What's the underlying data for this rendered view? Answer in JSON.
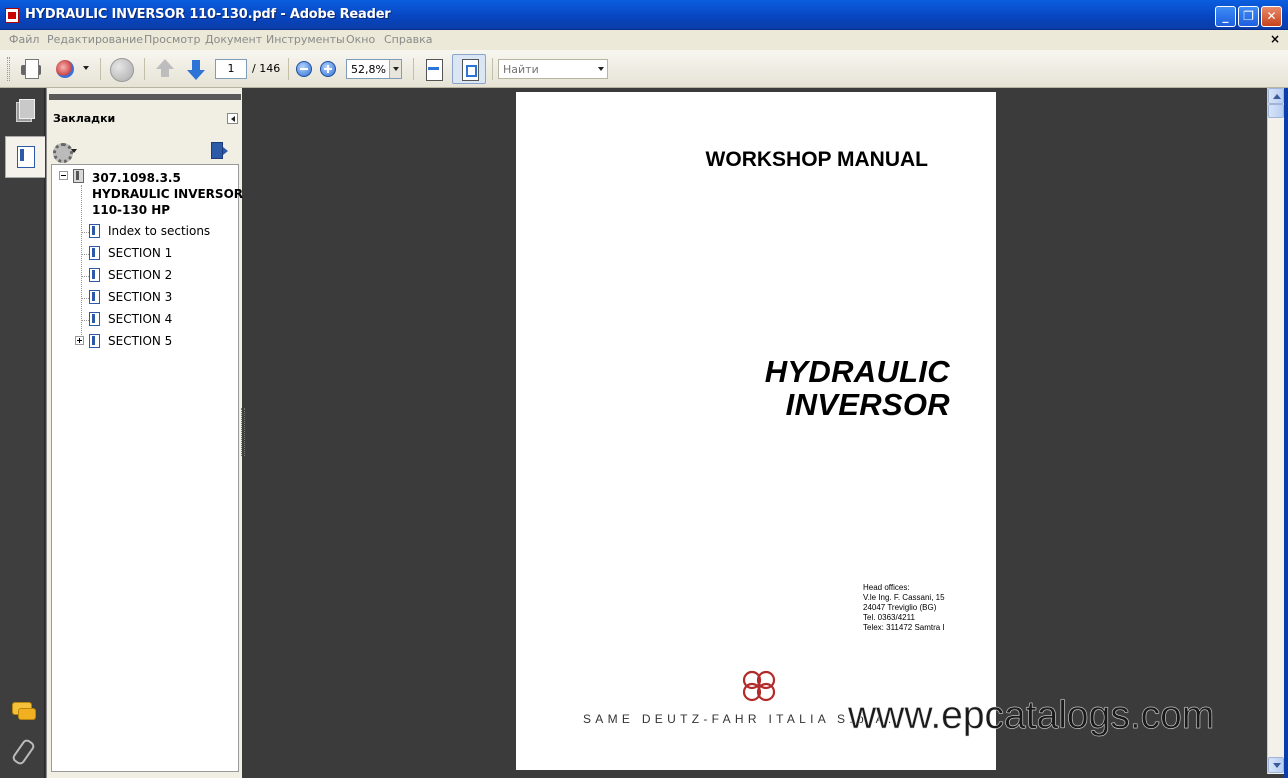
{
  "window": {
    "title": "HYDRAULIC INVERSOR 110-130.pdf - Adobe Reader",
    "min_label": "_",
    "max_label": "❐",
    "close_label": "✕"
  },
  "menu": {
    "items": [
      "Файл",
      "Редактирование",
      "Просмотр",
      "Документ",
      "Инструменты",
      "Окно",
      "Справка"
    ],
    "close_label": "×"
  },
  "toolbar": {
    "page_current": "1",
    "page_total": "/ 146",
    "zoom": "52,8%",
    "find_placeholder": "Найти"
  },
  "bookmarks": {
    "title": "Закладки",
    "root": {
      "line1": "307.1098.3.5",
      "line2": "HYDRAULIC INVERSOR",
      "line3": "110-130 HP"
    },
    "items": [
      "Index to sections",
      "SECTION 1",
      "SECTION 2",
      "SECTION 3",
      "SECTION 4",
      "SECTION 5"
    ]
  },
  "document": {
    "heading": "WORKSHOP MANUAL",
    "title_line1": "HYDRAULIC",
    "title_line2": "INVERSOR",
    "head_offices": {
      "label": "Head offices:",
      "address1": "V.le Ing. F. Cassani, 15",
      "address2": "24047 Treviglio (BG)",
      "tel": "Tel. 0363/4211",
      "telex": "Telex: 311472 Samtra I"
    },
    "company": "SAME DEUTZ-FAHR ITALIA S.p.A.",
    "logo_color": "#b22a2a"
  },
  "watermark": "www.epcatalogs.com",
  "colors": {
    "titlebar": "#0a5fe0",
    "workspace": "#3b3b3b",
    "panel": "#f1efe4"
  }
}
